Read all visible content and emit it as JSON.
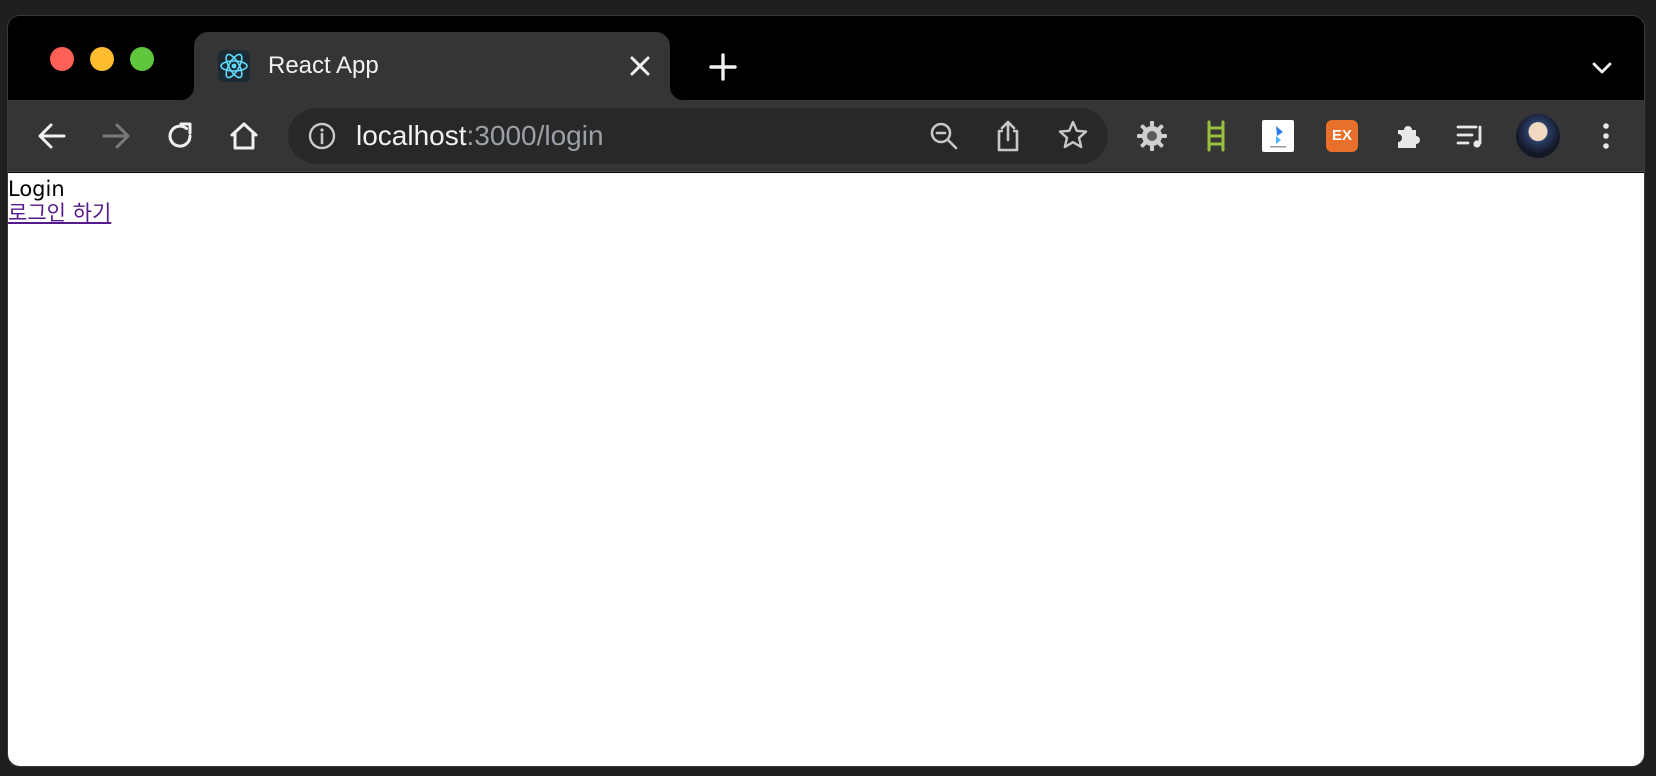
{
  "browser": {
    "tab": {
      "title": "React App",
      "favicon": "react-atom-icon"
    },
    "address_bar": {
      "host": "localhost",
      "path": ":3000/login"
    },
    "extensions": {
      "ex_label": "EX"
    },
    "colors": {
      "traffic_red": "#fe5f57",
      "traffic_yellow": "#febc2e",
      "traffic_green": "#5fc63d",
      "link_visited": "#551a8b",
      "ex_badge": "#e8702a"
    }
  },
  "page": {
    "heading": "Login",
    "login_link": "로그인 하기"
  }
}
